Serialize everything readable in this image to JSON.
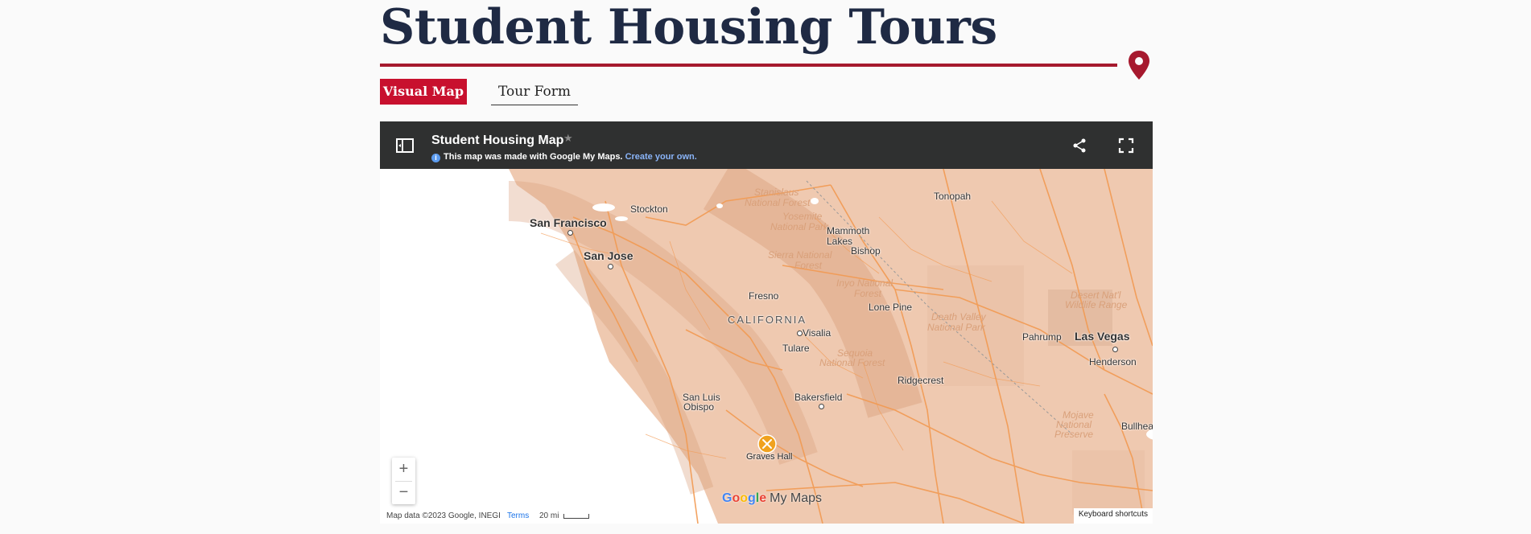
{
  "header": {
    "title": "Student Housing Tours"
  },
  "tabs": {
    "active_label": "Visual Map",
    "inactive_label": "Tour Form"
  },
  "map": {
    "title": "Student Housing Map",
    "made_with": "This map was made with Google My Maps.",
    "create_link": "Create your own.",
    "attribution": "Map data ©2023 Google, INEGI",
    "terms": "Terms",
    "scale": "20 mi",
    "keyboard_shortcuts": "Keyboard shortcuts",
    "zoom_in": "+",
    "zoom_out": "−",
    "logo_text": "My Maps",
    "marker_label": "Graves Hall",
    "places": {
      "stockton": "Stockton",
      "san_francisco": "San Francisco",
      "san_jose": "San Jose",
      "stanislaus": "Stanislaus",
      "national_forest": "National Forest",
      "yosemite": "Yosemite",
      "national_park": "National Park",
      "mammoth": "Mammoth",
      "lakes": "Lakes",
      "bishop": "Bishop",
      "sierra": "Sierra National",
      "forest": "Forest",
      "inyo": "Inyo National",
      "fresno": "Fresno",
      "california": "CALIFORNIA",
      "lone_pine": "Lone Pine",
      "death_valley": "Death Valley",
      "visalia": "Visalia",
      "tulare": "Tulare",
      "sequoia": "Sequoia",
      "pahrump": "Pahrump",
      "las_vegas": "Las Vegas",
      "henderson": "Henderson",
      "ridgecrest": "Ridgecrest",
      "san_luis": "San Luis",
      "obispo": "Obispo",
      "bakersfield": "Bakersfield",
      "tonopah": "Tonopah",
      "desert": "Desert Nat'l",
      "wildlife": "Wildlife Range",
      "mojave": "Mojave",
      "national": "National",
      "preserve": "Preserve",
      "bullhead": "Bullhea"
    }
  },
  "colors": {
    "accent": "#c8102e",
    "rule": "#a6192e",
    "title": "#1f2a44",
    "map_header": "#2f3030",
    "land": "#efc9b0",
    "ocean": "#ffffff",
    "roads": "#f29a52"
  }
}
